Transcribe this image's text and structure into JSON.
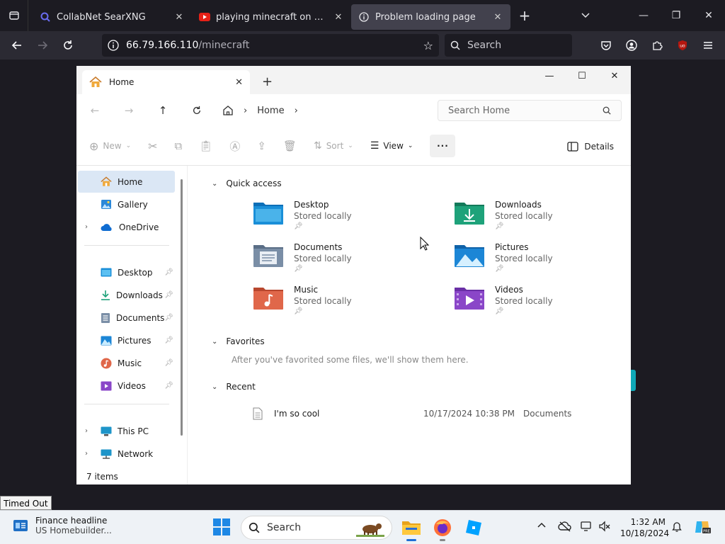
{
  "browser": {
    "tabs": [
      {
        "title": "CollabNet SearXNG",
        "active": false
      },
      {
        "title": "playing minecraft on windows",
        "active": false
      },
      {
        "title": "Problem loading page",
        "active": true
      }
    ],
    "url_host": "66.79.166.110",
    "url_path": "/minecraft",
    "search_placeholder": "Search"
  },
  "timeout_label": "Timed Out",
  "explorer": {
    "tab_title": "Home",
    "breadcrumb": "Home",
    "search_placeholder": "Search Home",
    "toolbar": {
      "new": "New",
      "sort": "Sort",
      "view": "View",
      "details": "Details"
    },
    "sidebar": {
      "top": [
        {
          "label": "Home",
          "icon": "home-icon",
          "selected": true
        },
        {
          "label": "Gallery",
          "icon": "gallery-icon"
        },
        {
          "label": "OneDrive",
          "icon": "onedrive-icon",
          "expandable": true
        }
      ],
      "pinned": [
        {
          "label": "Desktop",
          "icon": "desktop-folder-icon"
        },
        {
          "label": "Downloads",
          "icon": "downloads-folder-icon"
        },
        {
          "label": "Documents",
          "icon": "documents-folder-icon"
        },
        {
          "label": "Pictures",
          "icon": "pictures-folder-icon"
        },
        {
          "label": "Music",
          "icon": "music-folder-icon"
        },
        {
          "label": "Videos",
          "icon": "videos-folder-icon"
        }
      ],
      "bottom": [
        {
          "label": "This PC",
          "icon": "this-pc-icon"
        },
        {
          "label": "Network",
          "icon": "network-icon"
        }
      ]
    },
    "status": "7 items",
    "sections": {
      "quick_access": "Quick access",
      "favorites": "Favorites",
      "recent": "Recent"
    },
    "quick_access": [
      {
        "name": "Desktop",
        "sub": "Stored locally",
        "color": "#1a8fd8"
      },
      {
        "name": "Downloads",
        "sub": "Stored locally",
        "color": "#1ea27a"
      },
      {
        "name": "Documents",
        "sub": "Stored locally",
        "color": "#7a8ea6"
      },
      {
        "name": "Pictures",
        "sub": "Stored locally",
        "color": "#1c86d6"
      },
      {
        "name": "Music",
        "sub": "Stored locally",
        "color": "#e0674a"
      },
      {
        "name": "Videos",
        "sub": "Stored locally",
        "color": "#8a46c8"
      }
    ],
    "favorites_hint": "After you've favorited some files, we'll show them here.",
    "recent": [
      {
        "name": "I'm so cool",
        "date": "10/17/2024 10:38 PM",
        "location": "Documents"
      }
    ]
  },
  "taskbar": {
    "news_title": "Finance headline",
    "news_sub": "US Homebuilder...",
    "search_placeholder": "Search",
    "time": "1:32 AM",
    "date": "10/18/2024"
  }
}
